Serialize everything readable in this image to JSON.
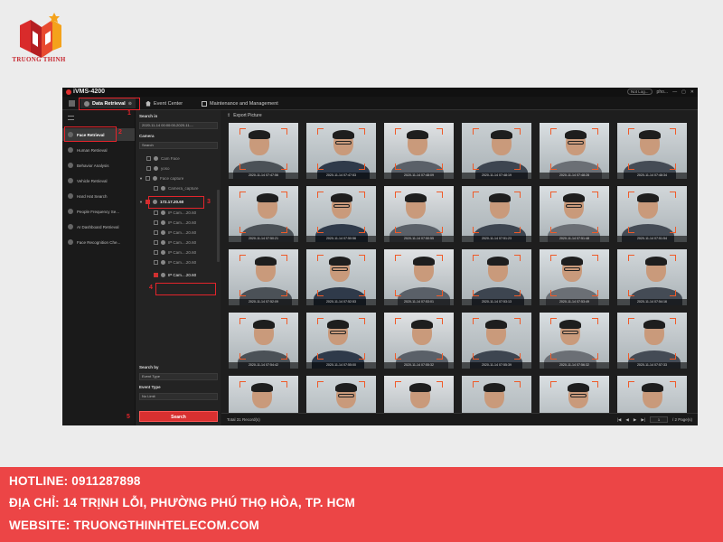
{
  "brand": {
    "name": "TRUONG THINH",
    "accent": "#e3242b"
  },
  "app": {
    "title": "iVMS-4200",
    "user": "Not Log...",
    "user2": "pho...",
    "tabs": [
      {
        "label": "Data Retrieval",
        "active": true
      },
      {
        "label": "Event Center",
        "active": false
      },
      {
        "label": "Maintenance and Management",
        "active": false
      }
    ],
    "nav": [
      {
        "label": "Face Retrieval",
        "active": true
      },
      {
        "label": "Human Retrieval"
      },
      {
        "label": "Behavior Analysis"
      },
      {
        "label": "Vehicle Retrieval"
      },
      {
        "label": "Hard Hat Search"
      },
      {
        "label": "People Frequency Se..."
      },
      {
        "label": "AI Dashboard Retrieval"
      },
      {
        "label": "Face Recognition Che..."
      }
    ],
    "panel": {
      "search_in_label": "Search in",
      "search_in_value": "2020-11-14 00:00:00-2020-11-...",
      "camera_label": "Camera",
      "search_placeholder": "Search",
      "tree": [
        {
          "label": "Cam Face"
        },
        {
          "label": "yoso"
        },
        {
          "label": "Face capture"
        },
        {
          "label": "Camera_capture"
        },
        {
          "label": "172.17.20.60"
        },
        {
          "label": "IP Cam....20.60"
        },
        {
          "label": "IP Cam....20.60"
        },
        {
          "label": "IP Cam....20.60"
        },
        {
          "label": "IP Cam....20.60"
        },
        {
          "label": "IP Cam....20.60"
        },
        {
          "label": "IP Cam....20.60"
        },
        {
          "label": "IP Cam....20.60"
        }
      ],
      "search_by_label": "Search by",
      "search_by_value": "Event Type",
      "event_type_label": "Event Type",
      "event_type_value": "No Limit",
      "search_button": "Search"
    },
    "annotations": [
      "1",
      "2",
      "3",
      "4",
      "5"
    ],
    "gallery": {
      "export_label": "Export Picture",
      "timestamps": [
        "2020-11-14 07:47:56",
        "2020-11-14 07:47:53",
        "2020-11-14 07:48:09",
        "2020-11-14 07:48:19",
        "2020-11-14 07:48:28",
        "2020-11-14 07:48:34",
        "2020-11-14 07:50:21",
        "2020-11-14 07:50:56",
        "2020-11-14 07:50:55",
        "2020-11-14 07:51:23",
        "2020-11-14 07:51:48",
        "2020-11-14 07:51:54",
        "2020-11-14 07:52:09",
        "2020-11-14 07:52:53",
        "2020-11-14 07:53:01",
        "2020-11-14 07:53:13",
        "2020-11-14 07:53:49",
        "2020-11-14 07:54:16",
        "2020-11-14 07:54:42",
        "2020-11-14 07:55:00",
        "2020-11-14 07:55:32",
        "2020-11-14 07:55:39",
        "2020-11-14 07:56:32",
        "2020-11-14 07:57:33",
        "",
        "",
        "",
        "",
        "",
        ""
      ],
      "total": "Total 31 Record(s)",
      "page_value": "1",
      "page_total": "/ 2 Page(s)"
    }
  },
  "footer": {
    "hotline": "HOTLINE: 0911287898",
    "address": "ĐỊA CHỈ: 14 TRỊNH LỖI, PHƯỜNG PHÚ THỌ HÒA, TP. HCM",
    "website": "WEBSITE: TRUONGTHINHTELECOM.COM"
  }
}
